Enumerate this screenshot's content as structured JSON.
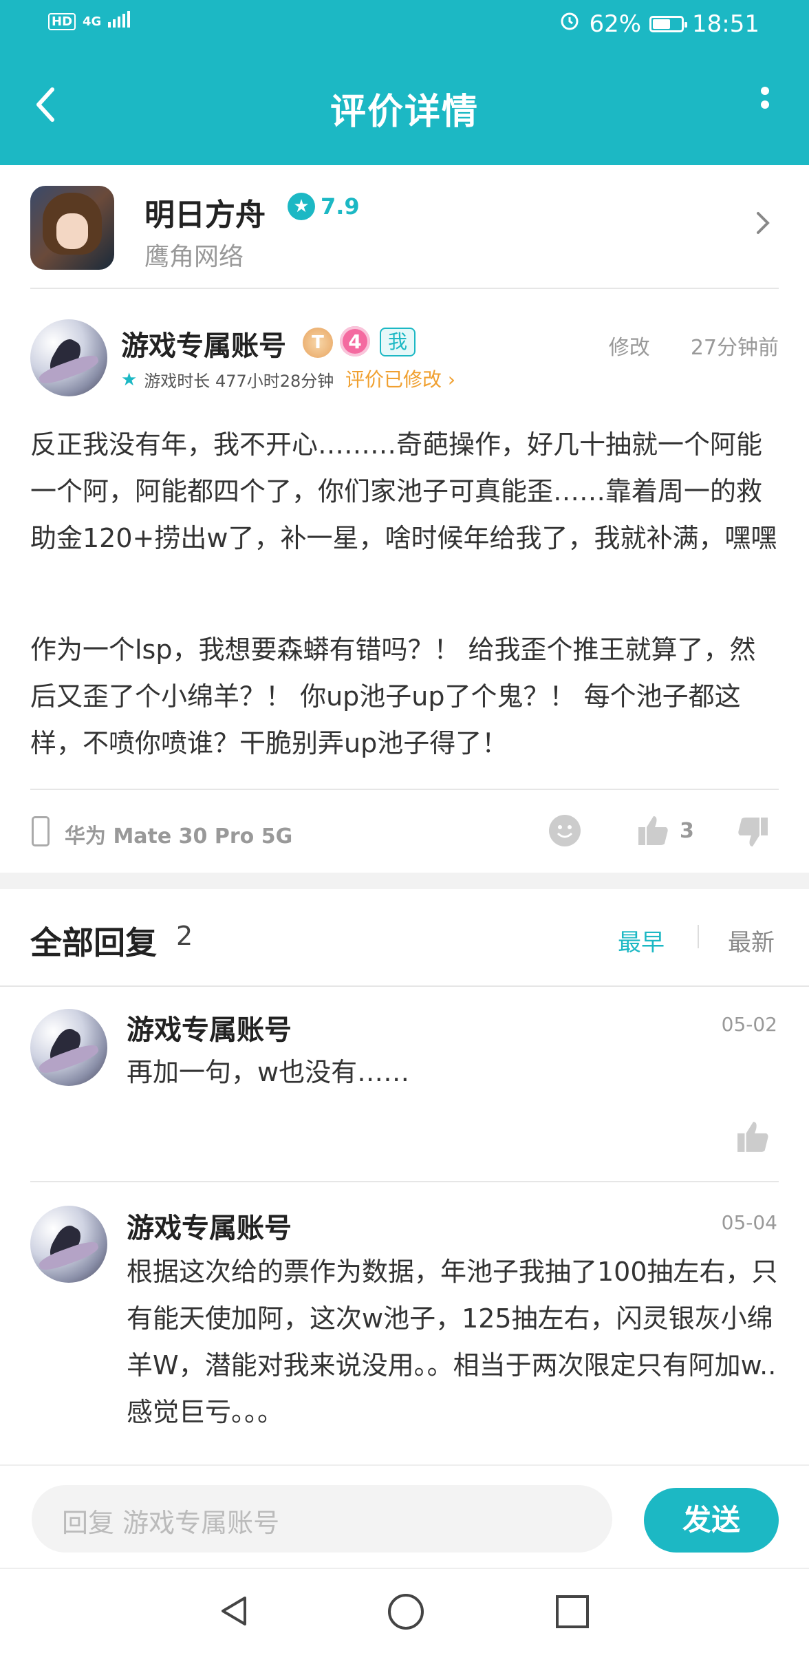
{
  "status_bar": {
    "left_labels": [
      "HD",
      "4G"
    ],
    "battery_percent": "62%",
    "battery_level": 0.62,
    "time": "18:51"
  },
  "header": {
    "title": "评价详情"
  },
  "game": {
    "name": "明日方舟",
    "score": "7.9",
    "developer": "鹰角网络"
  },
  "review": {
    "username": "游戏专属账号",
    "badge_t": "T",
    "badge_level": "4",
    "badge_me": "我",
    "edit_label": "修改",
    "time_ago": "27分钟前",
    "playtime": "游戏时长 477小时28分钟",
    "modified_label": "评价已修改 ›",
    "paragraphs": [
      "反正我没有年，我不开心………奇葩操作，好几十抽就一个阿能一个阿，阿能都四个了，你们家池子可真能歪……靠着周一的救助金120+捞出w了，补一星，啥时候年给我了，我就补满，嘿嘿",
      "作为一个lsp，我想要森蟒有错吗？！ 给我歪个推王就算了，然后又歪了个小绵羊？！ 你up池子up了个鬼？！ 每个池子都这样，不喷你喷谁？干脆别弄up池子得了！"
    ],
    "device": "华为 Mate 30 Pro 5G",
    "like_count": "3"
  },
  "replies": {
    "title": "全部回复",
    "count": "2",
    "sort_earliest": "最早",
    "sort_latest": "最新",
    "items": [
      {
        "username": "游戏专属账号",
        "date": "05-02",
        "text": "再加一句，w也没有……"
      },
      {
        "username": "游戏专属账号",
        "date": "05-04",
        "text": "根据这次给的票作为数据，年池子我抽了100抽左右，只有能天使加阿，这次w池子，125抽左右，闪灵银灰小绵羊W，潜能对我来说没用。。相当于两次限定只有阿加w..感觉巨亏。。。"
      }
    ]
  },
  "reply_bar": {
    "placeholder": "回复 游戏专属账号",
    "send_label": "发送"
  },
  "colors": {
    "accent": "#1cb8c4",
    "orange": "#f0a030"
  }
}
